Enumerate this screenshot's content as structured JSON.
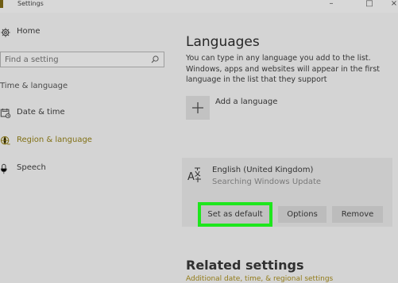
{
  "window": {
    "title": "Settings",
    "controls": {
      "minimize": "–",
      "maximize": "□",
      "close": "×"
    }
  },
  "sidebar": {
    "home_label": "Home",
    "search": {
      "placeholder": "Find a setting",
      "value": ""
    },
    "section_heading": "Time & language",
    "items": [
      {
        "label": "Date & time",
        "icon": "date-time-icon"
      },
      {
        "label": "Region & language",
        "icon": "region-language-icon",
        "selected": true
      },
      {
        "label": "Speech",
        "icon": "microphone-icon"
      }
    ]
  },
  "main": {
    "title": "Languages",
    "intro": "You can type in any language you add to the list. Windows, apps and websites will appear in the first language in the list that they support",
    "add_language_label": "Add a language",
    "language": {
      "name": "English (United Kingdom)",
      "status": "Searching Windows Update",
      "actions": {
        "set_default": "Set as default",
        "options": "Options",
        "remove": "Remove"
      }
    },
    "related_settings": {
      "title": "Related settings",
      "link": "Additional date, time, & regional settings"
    }
  },
  "colors": {
    "background": "#d4d4d4",
    "accent": "#827116",
    "highlight": "#1ee61d",
    "button": "#bcbcbc"
  }
}
